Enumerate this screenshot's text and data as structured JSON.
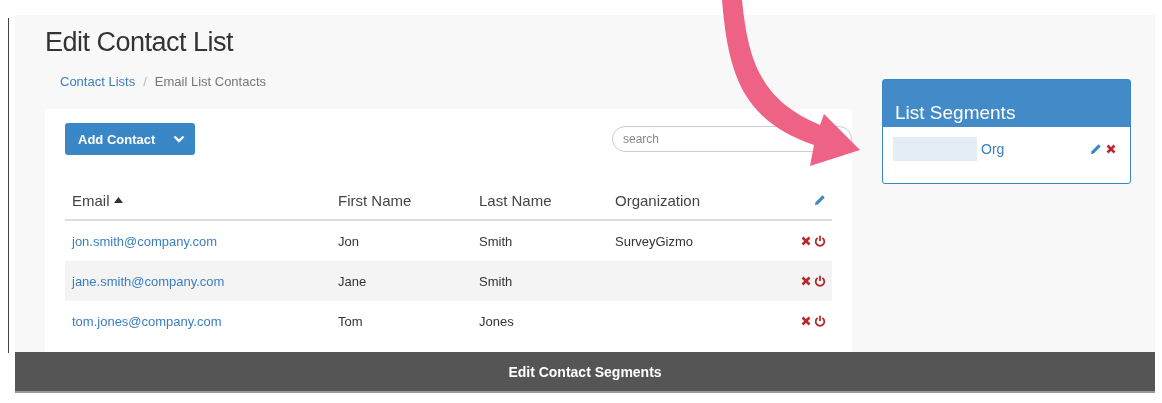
{
  "page": {
    "title": "Edit Contact List"
  },
  "breadcrumbs": [
    {
      "label": "Contact Lists",
      "kind": "link"
    },
    {
      "label": "/",
      "kind": "separator"
    },
    {
      "label": "Email List Contacts",
      "kind": "current"
    }
  ],
  "toolbar": {
    "add_button": "Add Contact",
    "search": {
      "placeholder": "search"
    }
  },
  "table": {
    "columns": [
      {
        "label": "Email",
        "sorted": true
      },
      {
        "label": "First Name",
        "sorted": false
      },
      {
        "label": "Last Name",
        "sorted": false
      },
      {
        "label": "Organization",
        "sorted": false
      }
    ],
    "rows": [
      {
        "email": "jon.smith@company.com",
        "first": "Jon",
        "last": "Smith",
        "org": "SurveyGizmo"
      },
      {
        "email": "jane.smith@company.com",
        "first": "Jane",
        "last": "Smith",
        "org": ""
      },
      {
        "email": "tom.jones@company.com",
        "first": "Tom",
        "last": "Jones",
        "org": ""
      }
    ]
  },
  "segments": {
    "title": "List Segments",
    "items": [
      {
        "label": "Org",
        "redacted": true
      }
    ]
  },
  "caption": "Edit Contact Segments"
}
